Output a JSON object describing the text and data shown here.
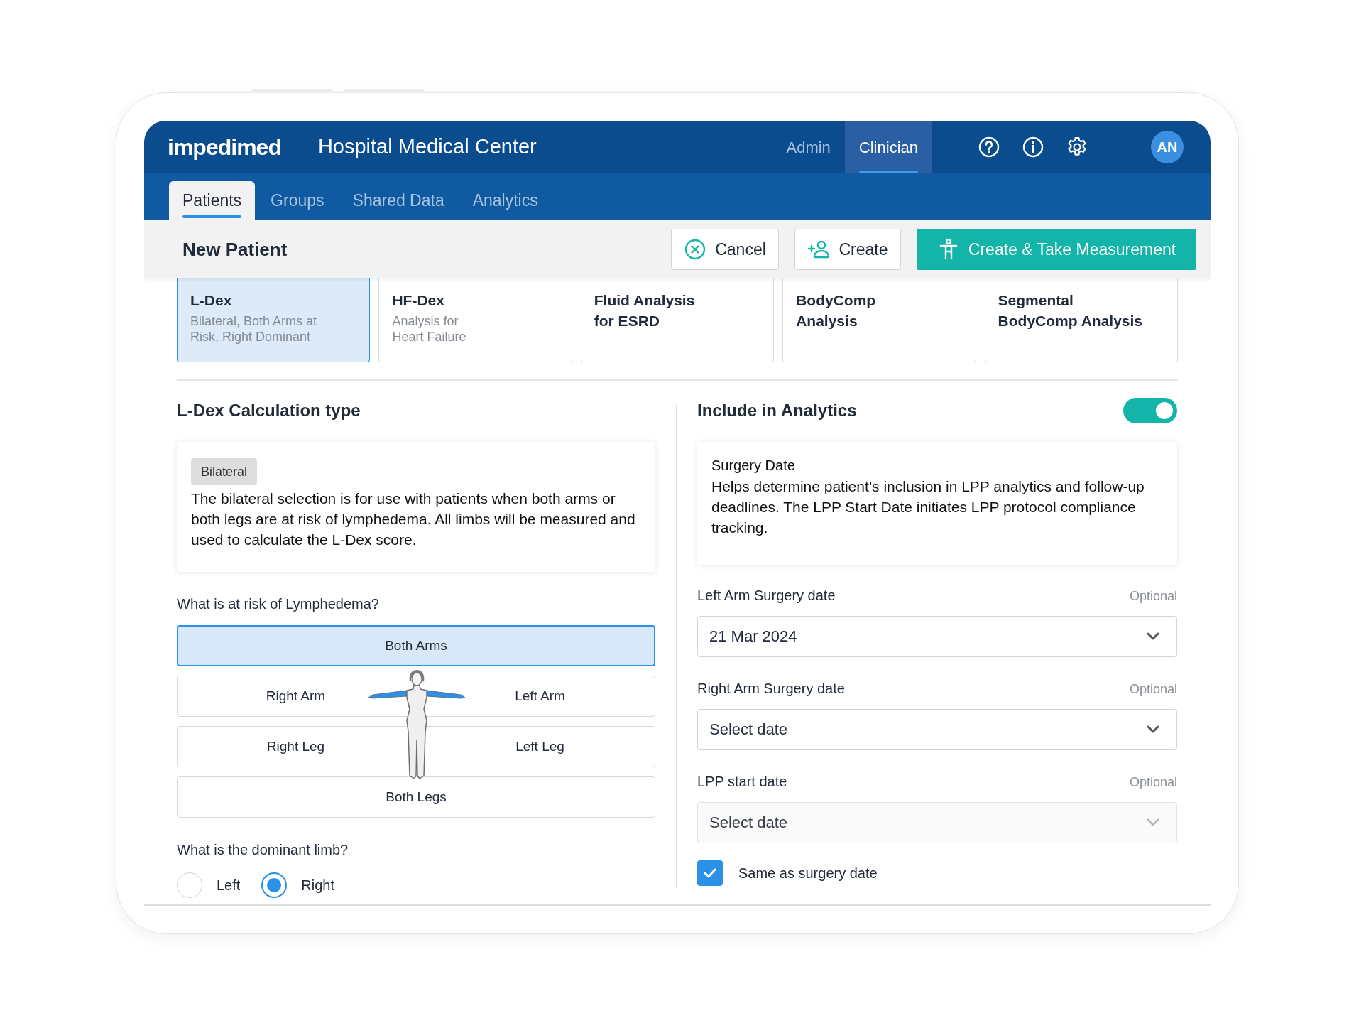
{
  "header": {
    "logo": "impedimed",
    "organization": "Hospital Medical Center",
    "roles": [
      {
        "label": "Admin",
        "selected": false
      },
      {
        "label": "Clinician",
        "selected": true
      }
    ],
    "avatar": "AN"
  },
  "tabs": [
    {
      "label": "Patients",
      "selected": true
    },
    {
      "label": "Groups",
      "selected": false
    },
    {
      "label": "Shared Data",
      "selected": false
    },
    {
      "label": "Analytics",
      "selected": false
    }
  ],
  "toolbar": {
    "title": "New Patient",
    "buttons": [
      {
        "label": "Cancel",
        "kind": "cancel"
      },
      {
        "label": "Create",
        "kind": "create"
      },
      {
        "label": "Create & Take Measurement",
        "kind": "measure"
      }
    ]
  },
  "test_cards": [
    {
      "title": "L-Dex",
      "subtitle": "Bilateral, Both Arms at\nRisk, Right Dominant",
      "selected": true
    },
    {
      "title": "HF-Dex",
      "subtitle": "Analysis for\nHeart Failure",
      "selected": false
    },
    {
      "title": "Fluid Analysis\nfor ESRD",
      "selected": false
    },
    {
      "title": "BodyComp\nAnalysis",
      "selected": false
    },
    {
      "title": "Segmental\nBodyComp Analysis",
      "selected": false
    }
  ],
  "calculation": {
    "heading": "L-Dex Calculation type",
    "badge": "Bilateral",
    "description": "The bilateral selection is for use with patients when both arms or both legs are at risk of lymphedema. All limbs will be measured and used to calculate the L-Dex score.",
    "risk_question": "What is at risk of Lymphedema?",
    "risk_rows": [
      [
        {
          "label": "Both Arms",
          "selected": true
        }
      ],
      [
        {
          "label": "Right Arm",
          "selected": false
        },
        {
          "label": "Left Arm",
          "selected": false
        }
      ],
      [
        {
          "label": "Right Leg",
          "selected": false
        },
        {
          "label": "Left Leg",
          "selected": false
        }
      ],
      [
        {
          "label": "Both Legs",
          "selected": false
        }
      ]
    ],
    "dominant_question": "What is the dominant limb?",
    "dominant_options": [
      {
        "label": "Left",
        "selected": false
      },
      {
        "label": "Right",
        "selected": true
      }
    ]
  },
  "analytics": {
    "heading": "Include in Analytics",
    "on": true,
    "info_title": "Surgery Date",
    "info_text": "Helps determine patient’s inclusion in LPP analytics and follow-up deadlines. The LPP Start Date initiates LPP protocol compliance tracking.",
    "fields": [
      {
        "label": "Left Arm Surgery date",
        "hint": "Optional",
        "value": "21 Mar 2024",
        "disabled": false
      },
      {
        "label": "Right Arm Surgery date",
        "hint": "Optional",
        "placeholder": "Select date",
        "disabled": false
      },
      {
        "label": "LPP start date",
        "hint": "Optional",
        "placeholder": "Select date",
        "disabled": true
      }
    ],
    "checkbox": {
      "label": "Same as surgery date",
      "checked": true
    }
  }
}
